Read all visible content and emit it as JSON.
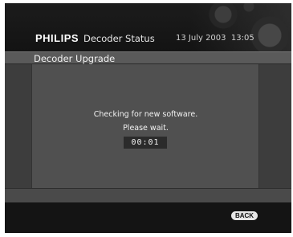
{
  "header": {
    "brand": "PHILIPS",
    "title": "Decoder Status",
    "datetime": "13 July 2003  13:05"
  },
  "subheader": {
    "title": "Decoder Upgrade"
  },
  "content": {
    "message_line1": "Checking for new software.",
    "message_line2": "Please wait.",
    "timer": "00:01"
  },
  "footer": {
    "back_label": "BACK"
  }
}
